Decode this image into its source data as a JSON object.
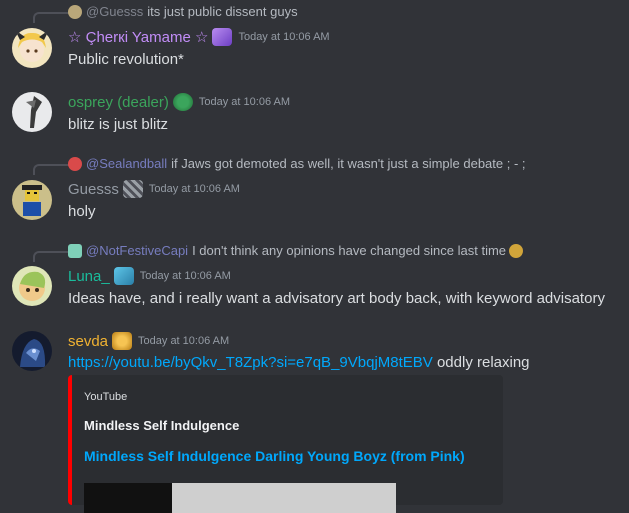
{
  "messages": [
    {
      "reply": {
        "mention": "@Guesss",
        "text": "its just public dissent guys"
      },
      "username": "☆ Çherкi Yamame ☆",
      "name_color": "#c28df7",
      "timestamp": "Today at 10:06 AM",
      "content": "Public revolution*",
      "avatar_icon": "blonde-anime-girl-avatar"
    },
    {
      "username": "osprey (dealer)",
      "name_color": "#3ba55c",
      "timestamp": "Today at 10:06 AM",
      "content": "blitz is just blitz",
      "avatar_icon": "bird-avatar"
    },
    {
      "reply": {
        "mention": "@Sealandball",
        "text": "if Jaws got demoted as well, it wasn't just a simple debate ; - ;"
      },
      "username": "Guesss",
      "name_color": "#949ba4",
      "timestamp": "Today at 10:06 AM",
      "content": "holy",
      "avatar_icon": "roblox-avatar"
    },
    {
      "reply": {
        "mention": "@NotFestiveCapi",
        "text": "I don't think any opinions have changed since last time"
      },
      "username": "Luna_",
      "name_color": "#1abc9c",
      "timestamp": "Today at 10:06 AM",
      "content": "Ideas have, and i really want a advisatory art body back, with keyword advisatory",
      "avatar_icon": "cartoon-avatar"
    },
    {
      "username": "sevda",
      "name_color": "#f0b232",
      "timestamp": "Today at 10:06 AM",
      "link": "https://youtu.be/byQkv_T8Zpk?si=e7qB_9VbqjM8tEBV",
      "content_after": "oddly relaxing",
      "avatar_icon": "dark-blue-avatar"
    }
  ],
  "embed": {
    "provider": "YouTube",
    "author": "Mindless Self Indulgence",
    "title": "Mindless Self Indulgence Darling Young Boyz (from Pink)",
    "accent": "#ff0000"
  },
  "colors": {
    "background": "#313338",
    "text": "#dbdee1",
    "link": "#00a8fc",
    "muted": "#949ba4"
  }
}
